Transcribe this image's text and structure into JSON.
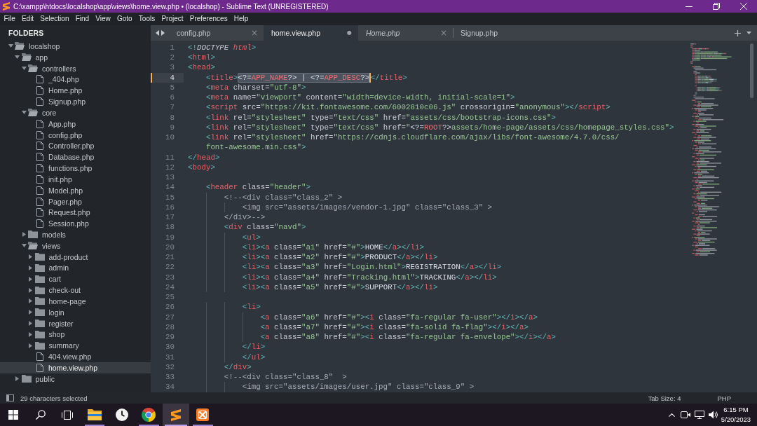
{
  "window": {
    "title": "C:\\xampp\\htdocs\\localshop\\app\\views\\home.view.php • (localshop) - Sublime Text (UNREGISTERED)"
  },
  "menu": [
    "File",
    "Edit",
    "Selection",
    "Find",
    "View",
    "Goto",
    "Tools",
    "Project",
    "Preferences",
    "Help"
  ],
  "sidebar": {
    "title": "FOLDERS",
    "items": [
      {
        "label": "localshop",
        "kind": "folder",
        "expanded": true,
        "selected": false,
        "children": [
          {
            "label": "app",
            "kind": "folder",
            "expanded": true,
            "selected": false,
            "children": [
              {
                "label": "controllers",
                "kind": "folder",
                "expanded": true,
                "selected": false,
                "children": [
                  {
                    "label": "_404.php",
                    "kind": "file",
                    "selected": false
                  },
                  {
                    "label": "Home.php",
                    "kind": "file",
                    "selected": false
                  },
                  {
                    "label": "Signup.php",
                    "kind": "file",
                    "selected": false
                  }
                ]
              },
              {
                "label": "core",
                "kind": "folder",
                "expanded": true,
                "selected": false,
                "children": [
                  {
                    "label": "App.php",
                    "kind": "file",
                    "selected": false
                  },
                  {
                    "label": "config.php",
                    "kind": "file",
                    "selected": false
                  },
                  {
                    "label": "Controller.php",
                    "kind": "file",
                    "selected": false
                  },
                  {
                    "label": "Database.php",
                    "kind": "file",
                    "selected": false
                  },
                  {
                    "label": "functions.php",
                    "kind": "file",
                    "selected": false
                  },
                  {
                    "label": "init.php",
                    "kind": "file",
                    "selected": false
                  },
                  {
                    "label": "Model.php",
                    "kind": "file",
                    "selected": false
                  },
                  {
                    "label": "Pager.php",
                    "kind": "file",
                    "selected": false
                  },
                  {
                    "label": "Request.php",
                    "kind": "file",
                    "selected": false
                  },
                  {
                    "label": "Session.php",
                    "kind": "file",
                    "selected": false
                  }
                ]
              },
              {
                "label": "models",
                "kind": "folder",
                "expanded": false,
                "selected": false
              },
              {
                "label": "views",
                "kind": "folder",
                "expanded": true,
                "selected": false,
                "children": [
                  {
                    "label": "add-product",
                    "kind": "folder",
                    "expanded": false,
                    "selected": false
                  },
                  {
                    "label": "admin",
                    "kind": "folder",
                    "expanded": false,
                    "selected": false
                  },
                  {
                    "label": "cart",
                    "kind": "folder",
                    "expanded": false,
                    "selected": false
                  },
                  {
                    "label": "check-out",
                    "kind": "folder",
                    "expanded": false,
                    "selected": false
                  },
                  {
                    "label": "home-page",
                    "kind": "folder",
                    "expanded": false,
                    "selected": false
                  },
                  {
                    "label": "login",
                    "kind": "folder",
                    "expanded": false,
                    "selected": false
                  },
                  {
                    "label": "register",
                    "kind": "folder",
                    "expanded": false,
                    "selected": false
                  },
                  {
                    "label": "shop",
                    "kind": "folder",
                    "expanded": false,
                    "selected": false
                  },
                  {
                    "label": "summary",
                    "kind": "folder",
                    "expanded": false,
                    "selected": false
                  },
                  {
                    "label": "404.view.php",
                    "kind": "file",
                    "selected": false
                  },
                  {
                    "label": "home.view.php",
                    "kind": "file",
                    "selected": true
                  }
                ]
              }
            ]
          },
          {
            "label": "public",
            "kind": "folder",
            "expanded": false,
            "selected": false
          }
        ]
      }
    ]
  },
  "tabs": [
    {
      "label": "config.php",
      "selected": false,
      "preview": false,
      "close": "×"
    },
    {
      "label": "home.view.php",
      "selected": true,
      "preview": false,
      "modified_mark": "●"
    },
    {
      "label": "Home.php",
      "selected": false,
      "preview": true,
      "close": "×"
    },
    {
      "label": "Signup.php",
      "selected": false,
      "preview": false
    }
  ],
  "editor": {
    "lines": [
      {
        "number": "1",
        "current": false,
        "text": "<!DOCTYPE html>"
      },
      {
        "number": "2",
        "current": false,
        "text": "<html>"
      },
      {
        "number": "3",
        "current": false,
        "text": "<head>"
      },
      {
        "number": "4",
        "current": true,
        "segments": [
          {
            "text": "    <title>",
            "selected": false
          },
          {
            "text": "<?=APP_NAME?> | <?=APP_DESC?>",
            "selected": true
          },
          {
            "text": "</title>",
            "selected": false
          }
        ]
      },
      {
        "number": "5",
        "current": false,
        "text": "    <meta charset=\"utf-8\">"
      },
      {
        "number": "6",
        "current": false,
        "text": "    <meta name=\"viewport\" content=\"width=device-width, initial-scale=1\">"
      },
      {
        "number": "7",
        "current": false,
        "text": "    <script src=\"https://kit.fontawesome.com/6002810c06.js\" crossorigin=\"anonymous\"></script>"
      },
      {
        "number": "8",
        "current": false,
        "text": "    <link rel=\"stylesheet\" type=\"text/css\" href=\"assets/css/bootstrap-icons.css\">"
      },
      {
        "number": "9",
        "current": false,
        "text": "    <link rel=\"stylesheet\" type=\"text/css\" href=\"<?=ROOT?>assets/home-page/assets/css/homepage_styles.css\">"
      },
      {
        "number": "10",
        "current": false,
        "text": "    <link rel=\"stylesheet\" href=\"https://cdnjs.cloudflare.com/ajax/libs/font-awesome/4.7.0/css/",
        "wrapped": [
          "font-awesome.min.css\">"
        ]
      },
      {
        "number": "11",
        "current": false,
        "text": "</head>"
      },
      {
        "number": "12",
        "current": false,
        "text": "<body>"
      },
      {
        "number": "13",
        "current": false
      },
      {
        "number": "14",
        "current": false,
        "text": "    <header class=\"header\">"
      },
      {
        "number": "15",
        "current": false,
        "text": "        <!--<div class=\"class_2\" >"
      },
      {
        "number": "16",
        "current": false,
        "text": "            <img src=\"assets/images/vendor-1.jpg\" class=\"class_3\" >"
      },
      {
        "number": "17",
        "current": false,
        "text": "        </div>-->"
      },
      {
        "number": "18",
        "current": false,
        "text": "        <div class=\"navd\">"
      },
      {
        "number": "19",
        "current": false,
        "text": "            <ul>"
      },
      {
        "number": "20",
        "current": false,
        "text": "            <li><a class=\"a1\" href=\"#\">HOME</a></li>"
      },
      {
        "number": "21",
        "current": false,
        "text": "            <li><a class=\"a2\" href=\"#\">PRODUCT</a></li>"
      },
      {
        "number": "22",
        "current": false,
        "text": "            <li><a class=\"a3\" href=\"Login.html\">REGISTRATION</a></li>"
      },
      {
        "number": "23",
        "current": false,
        "text": "            <li><a class=\"a4\" href=\"Tracking.html\">TRACKING</a></li>"
      },
      {
        "number": "24",
        "current": false,
        "text": "            <li><a class=\"a5\" href=\"#\">SUPPORT</a></li>"
      },
      {
        "number": "25",
        "current": false
      },
      {
        "number": "26",
        "current": false,
        "text": "            <li>"
      },
      {
        "number": "27",
        "current": false,
        "text": "                <a class=\"a6\" href=\"#\"><i class=\"fa-regular fa-user\"></i></a>"
      },
      {
        "number": "28",
        "current": false,
        "text": "                <a class=\"a7\" href=\"#\"><i class=\"fa-solid fa-flag\"></i></a>"
      },
      {
        "number": "29",
        "current": false,
        "text": "                <a class=\"a8\" href=\"#\"><i class=\"fa-regular fa-envelope\"></i></a>"
      },
      {
        "number": "30",
        "current": false,
        "text": "            </li>"
      },
      {
        "number": "31",
        "current": false,
        "text": "            </ul>"
      },
      {
        "number": "32",
        "current": false,
        "text": "        </div>"
      },
      {
        "number": "33",
        "current": false,
        "text": "        <!--<div class=\"class_8\"  >"
      },
      {
        "number": "34",
        "current": false,
        "text": "            <img src=\"assets/images/user.jpg\" class=\"class_9\" >"
      }
    ]
  },
  "status_bar": {
    "message": "29 characters selected",
    "tab_size": "Tab Size: 4",
    "syntax": "PHP"
  },
  "taskbar": {
    "apps": [
      {
        "kind": "explorer",
        "running": true,
        "selected": false
      },
      {
        "kind": "clock",
        "running": false,
        "selected": false
      },
      {
        "kind": "browser",
        "running": true,
        "selected": false
      },
      {
        "kind": "editor",
        "running": true,
        "selected": true
      },
      {
        "kind": "server",
        "running": true,
        "selected": false
      }
    ],
    "time": "6:15 PM",
    "date": "5/20/2023"
  }
}
